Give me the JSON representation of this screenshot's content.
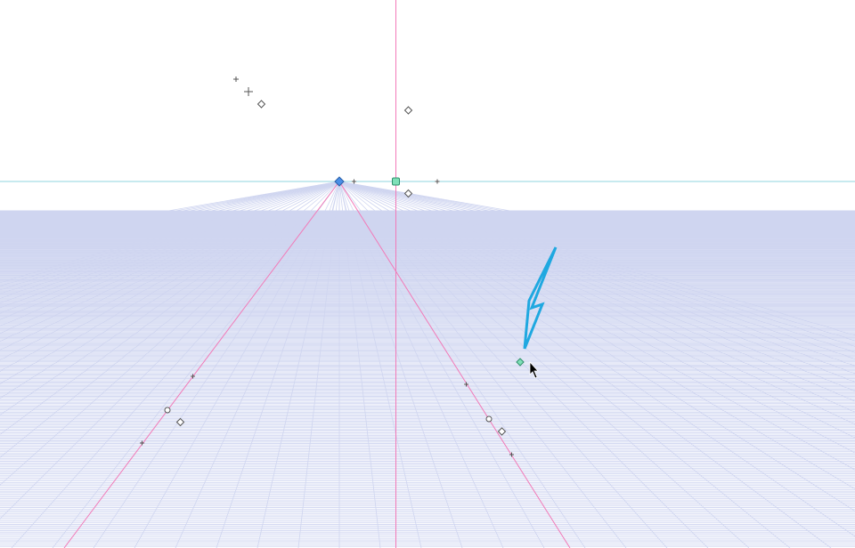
{
  "colors": {
    "background": "#ffffff",
    "grid": "#cfd5f0",
    "grid_dense": "#c9d0f0",
    "horizon": "#8fd6df",
    "guide": "#f27ab8",
    "marker_stroke": "#555555",
    "vanishing_point_fill": "#4a8fe6",
    "handle_fill": "#7fe0b8",
    "annotation_arrow": "#1fa8e0",
    "cursor": "#000000"
  },
  "icons": {
    "vanishing_point": "diamond-handle-icon",
    "eye_level_handle": "square-handle-icon",
    "guide_handle": "circle-handle-icon",
    "rotate_handle": "diamond-outline-icon",
    "move_handle": "cross-icon",
    "cursor": "arrow-cursor-icon",
    "annotation": "arrow-annotation-icon"
  }
}
